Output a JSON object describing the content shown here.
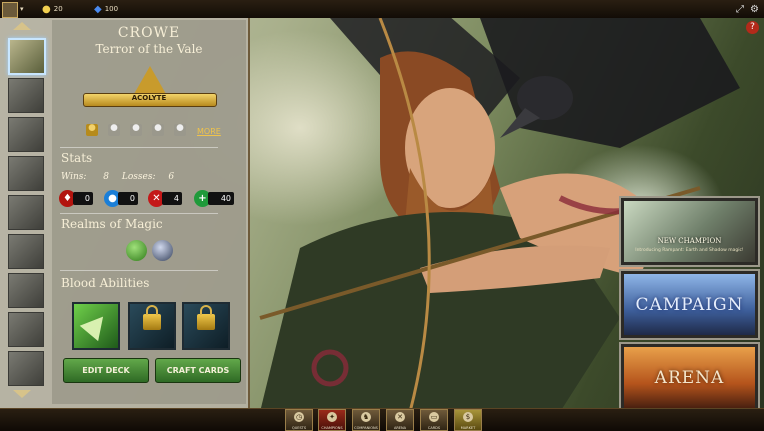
{
  "topbar": {
    "gold": "20",
    "gems": "100"
  },
  "hero": {
    "name": "CROWE",
    "title": "Terror of the Vale",
    "rank": "ACOLYTE",
    "more_label": "MORE"
  },
  "stats": {
    "heading": "Stats",
    "wins_label": "Wins:",
    "wins": "8",
    "losses_label": "Losses:",
    "losses": "6",
    "blood": "0",
    "mana": "0",
    "kills": "4",
    "heal": "40"
  },
  "realms": {
    "heading": "Realms of Magic"
  },
  "abilities": {
    "heading": "Blood Abilities"
  },
  "buttons": {
    "edit_deck": "EDIT DECK",
    "craft_cards": "CRAFT CARDS"
  },
  "modes": {
    "new_champion": "NEW CHAMPION",
    "new_champion_sub": "Introducing Rampant: Earth and Shadow magic!",
    "campaign": "CAMPAIGN",
    "arena": "ARENA"
  },
  "nav": {
    "items": [
      "QUESTS",
      "CHAMPIONS",
      "COMPANIONS",
      "ARENA",
      "CARDS",
      "MARKET"
    ]
  },
  "icons": {
    "help": "help-icon",
    "expand": "expand-icon",
    "settings": "settings-icon"
  }
}
